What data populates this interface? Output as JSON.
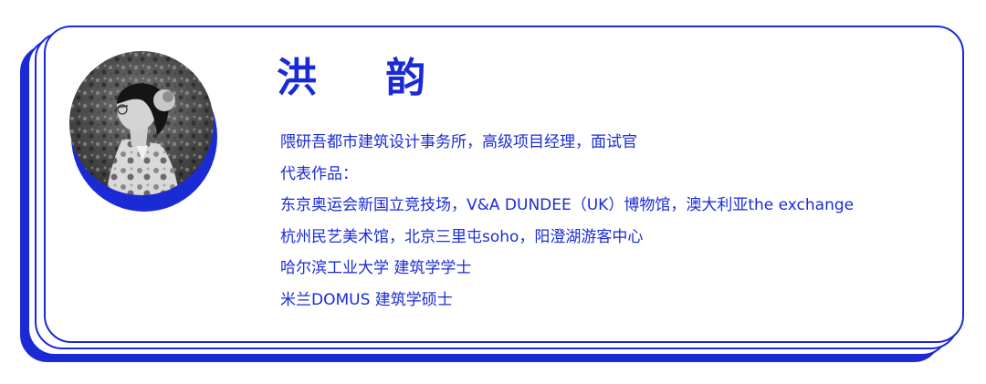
{
  "profile": {
    "name": "洪  韵",
    "lines": [
      "隈研吾都市建筑设计事务所，高级项目经理，面试官",
      "代表作品：",
      "东京奥运会新国立竞技场，V&A DUNDEE（UK）博物馆，澳大利亚the exchange",
      "杭州民艺美术馆，北京三里屯soho，阳澄湖游客中心",
      "哈尔滨工业大学 建筑学学士",
      "米兰DOMUS 建筑学硕士"
    ]
  },
  "colors": {
    "accent": "#1a2bd6",
    "background": "#ffffff"
  }
}
